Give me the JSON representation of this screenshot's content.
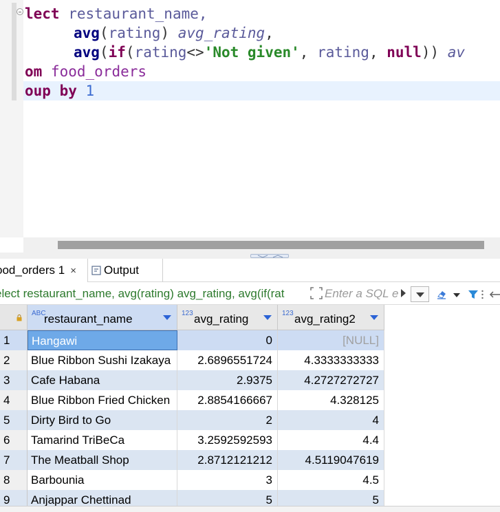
{
  "editor": {
    "lines": [
      {
        "kw": "lect",
        "id": " restaurant_name,"
      },
      {
        "fn": "avg",
        "open": "(",
        "arg": "rating",
        "close": ")",
        "alias": "avg_rating",
        "tail": ","
      },
      {
        "fn": "avg",
        "open1": "(",
        "fn2": "if",
        "open2": "(",
        "arg": "rating",
        "op": "<>",
        "str": "'Not given'",
        "comma1": ",",
        "arg2": " rating",
        "comma2": ",",
        "nullkw": " null",
        "close": "))",
        "alias": "av"
      },
      {
        "kw": "om",
        "tbl": " food_orders"
      },
      {
        "kw": "oup by",
        "num": " 1"
      }
    ]
  },
  "tabs": {
    "results_label": "ood_orders 1",
    "close_glyph": "×",
    "output_label": "Output"
  },
  "filter": {
    "query_text": "elect restaurant_name, avg(rating) avg_rating, avg(if(rat",
    "placeholder": "Enter a SQL e"
  },
  "grid": {
    "columns": [
      {
        "type": "ABC",
        "name": "restaurant_name"
      },
      {
        "type": "123",
        "name": "avg_rating"
      },
      {
        "type": "123",
        "name": "avg_rating2"
      }
    ],
    "rows": [
      {
        "num": "1",
        "restaurant_name": "Hangawi",
        "avg_rating": "0",
        "avg_rating2": "[NULL]"
      },
      {
        "num": "2",
        "restaurant_name": "Blue Ribbon Sushi Izakaya",
        "avg_rating": "2.6896551724",
        "avg_rating2": "4.3333333333"
      },
      {
        "num": "3",
        "restaurant_name": "Cafe Habana",
        "avg_rating": "2.9375",
        "avg_rating2": "4.2727272727"
      },
      {
        "num": "4",
        "restaurant_name": "Blue Ribbon Fried Chicken",
        "avg_rating": "2.8854166667",
        "avg_rating2": "4.328125"
      },
      {
        "num": "5",
        "restaurant_name": "Dirty Bird to Go",
        "avg_rating": "2",
        "avg_rating2": "4"
      },
      {
        "num": "6",
        "restaurant_name": "Tamarind TriBeCa",
        "avg_rating": "3.2592592593",
        "avg_rating2": "4.4"
      },
      {
        "num": "7",
        "restaurant_name": "The Meatball Shop",
        "avg_rating": "2.8712121212",
        "avg_rating2": "4.5119047619"
      },
      {
        "num": "8",
        "restaurant_name": "Barbounia",
        "avg_rating": "3",
        "avg_rating2": "4.5"
      },
      {
        "num": "9",
        "restaurant_name": "Anjappar Chettinad",
        "avg_rating": "5",
        "avg_rating2": "5"
      }
    ]
  }
}
